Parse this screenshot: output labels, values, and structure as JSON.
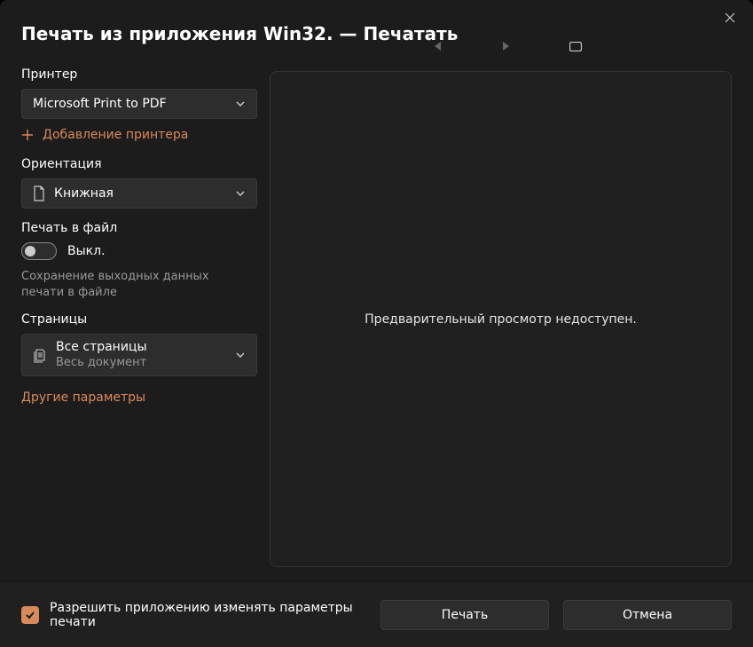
{
  "title": "Печать из приложения Win32. — Печатать",
  "printer": {
    "label": "Принтер",
    "selected": "Microsoft Print to PDF",
    "add_link": "Добавление принтера"
  },
  "orientation": {
    "label": "Ориентация",
    "selected": "Книжная"
  },
  "print_to_file": {
    "label": "Печать в файл",
    "state_label": "Выкл.",
    "hint": "Сохранение выходных данных печати в файле"
  },
  "pages": {
    "label": "Страницы",
    "selected": "Все страницы",
    "selected_sub": "Весь документ"
  },
  "other_settings": "Другие параметры",
  "preview": {
    "message": "Предварительный просмотр недоступен."
  },
  "footer": {
    "allow_app_label": "Разрешить приложению изменять параметры печати",
    "print_button": "Печать",
    "cancel_button": "Отмена"
  },
  "colors": {
    "accent": "#d98a5b"
  }
}
